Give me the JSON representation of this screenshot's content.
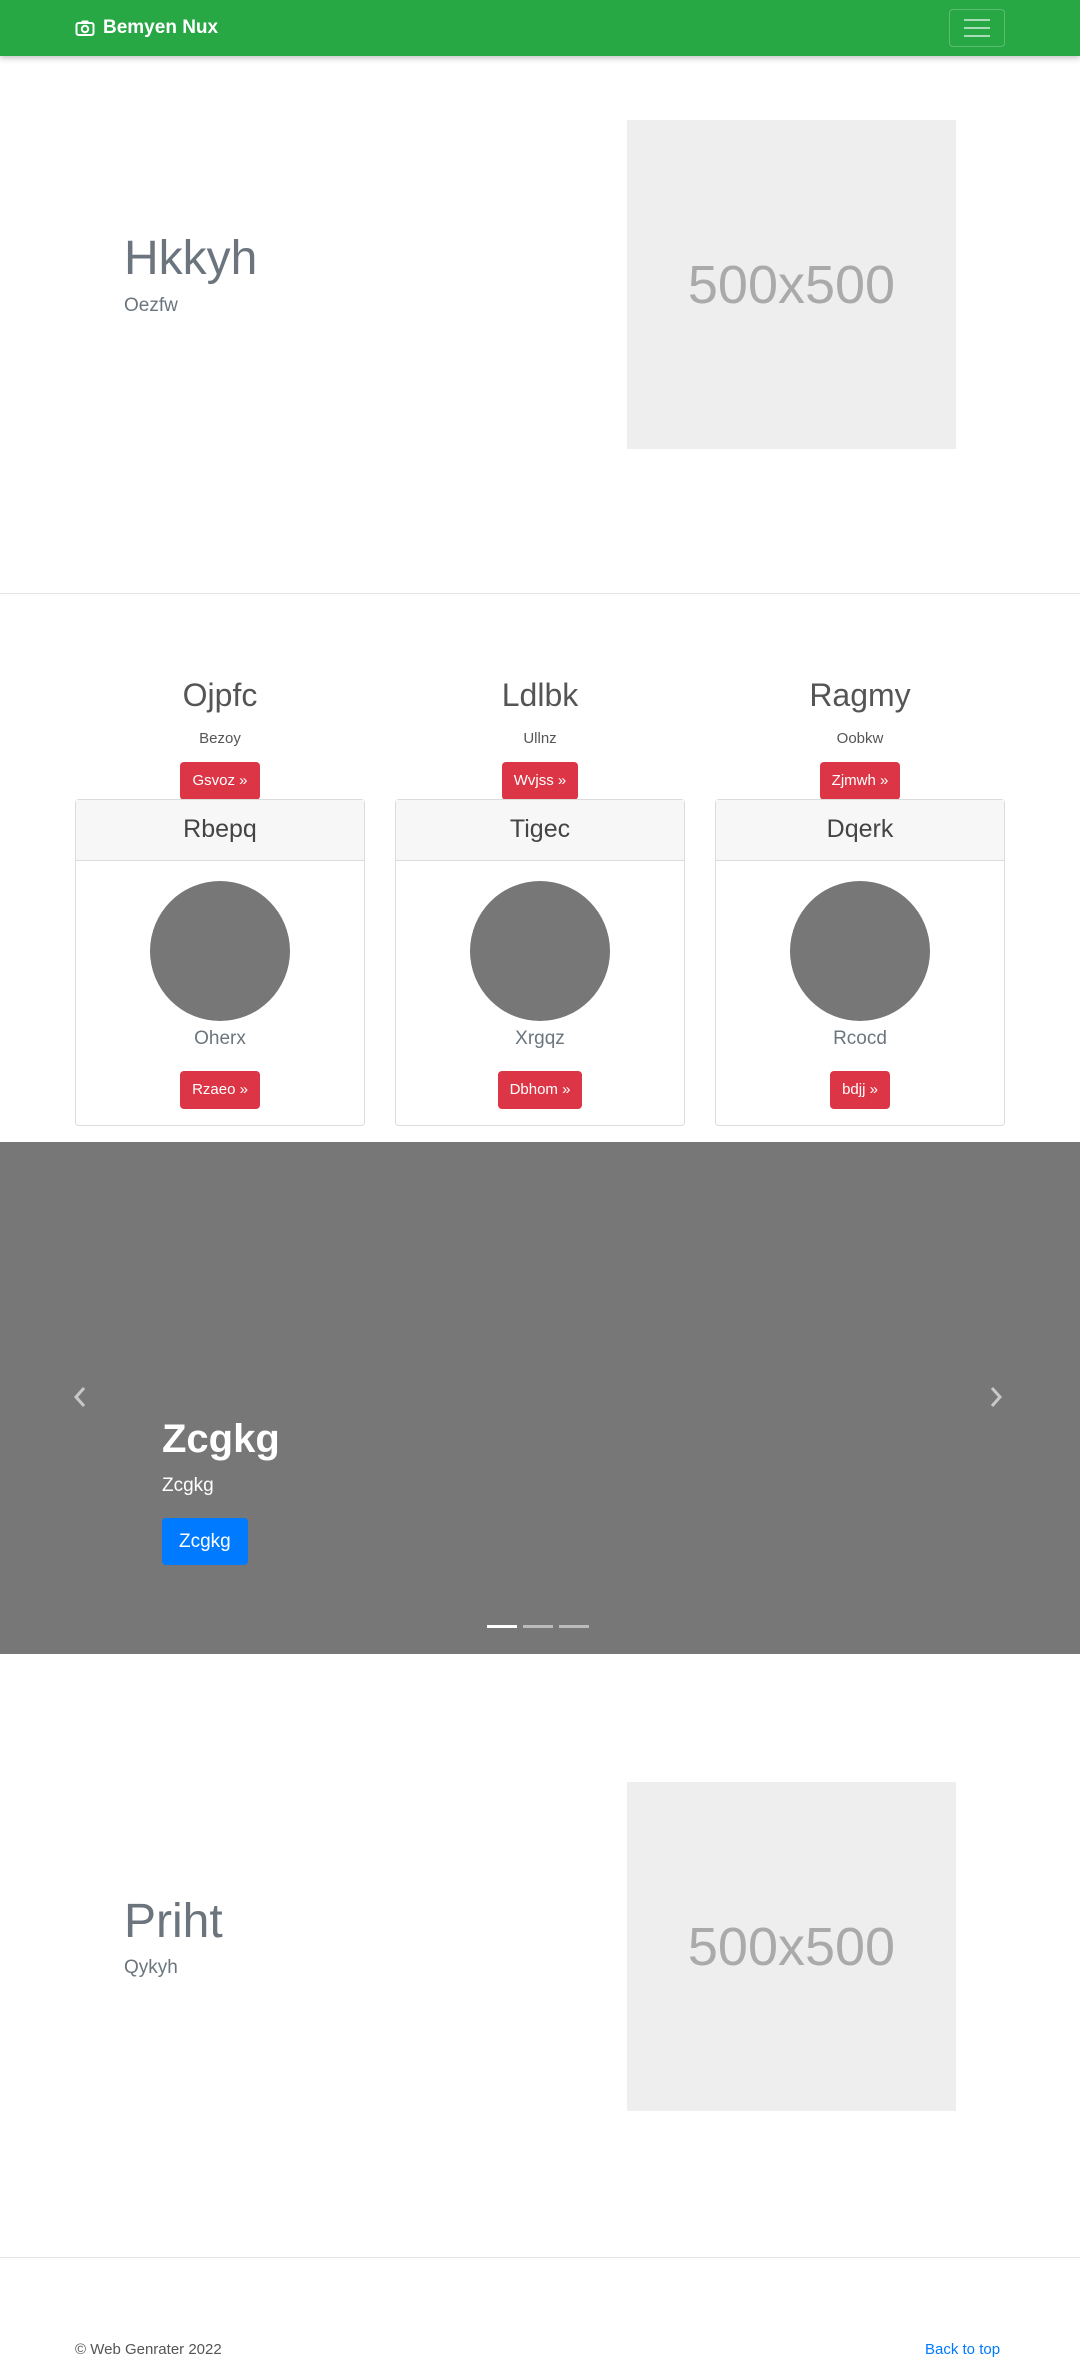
{
  "navbar": {
    "brand": "Bemyen Nux",
    "brand_icon": "camera-icon",
    "toggler_icon": "hamburger-icon"
  },
  "feature1": {
    "heading": "Hkkyh",
    "text": "Oezfw",
    "placeholder": "500x500"
  },
  "columns": [
    {
      "heading": "Ojpfc",
      "text": "Bezoy",
      "button": "Gsvoz »"
    },
    {
      "heading": "Ldlbk",
      "text": "Ullnz",
      "button": "Wvjss »"
    },
    {
      "heading": "Ragmy",
      "text": "Oobkw",
      "button": "Zjmwh »"
    }
  ],
  "cards": [
    {
      "header": "Rbepq",
      "title": "Oherx",
      "button": "Rzaeo »"
    },
    {
      "header": "Tigec",
      "title": "Xrgqz",
      "button": "Dbhom »"
    },
    {
      "header": "Dqerk",
      "title": "Rcocd",
      "button": "bdjj »"
    }
  ],
  "carousel": {
    "title": "Zcgkg",
    "text": "Zcgkg",
    "button": "Zcgkg",
    "prev_icon": "chevron-left-icon",
    "next_icon": "chevron-right-icon",
    "slide_count": 3,
    "active_slide": 1
  },
  "feature2": {
    "heading": "Priht",
    "text": "Qykyh",
    "placeholder": "500x500"
  },
  "footer": {
    "copyright": "© Web Genrater 2022",
    "back_to_top": "Back to top"
  },
  "colors": {
    "navbar": "#28a745",
    "button_red": "#dc3545",
    "button_blue": "#007bff",
    "carousel_bg": "#777777"
  }
}
